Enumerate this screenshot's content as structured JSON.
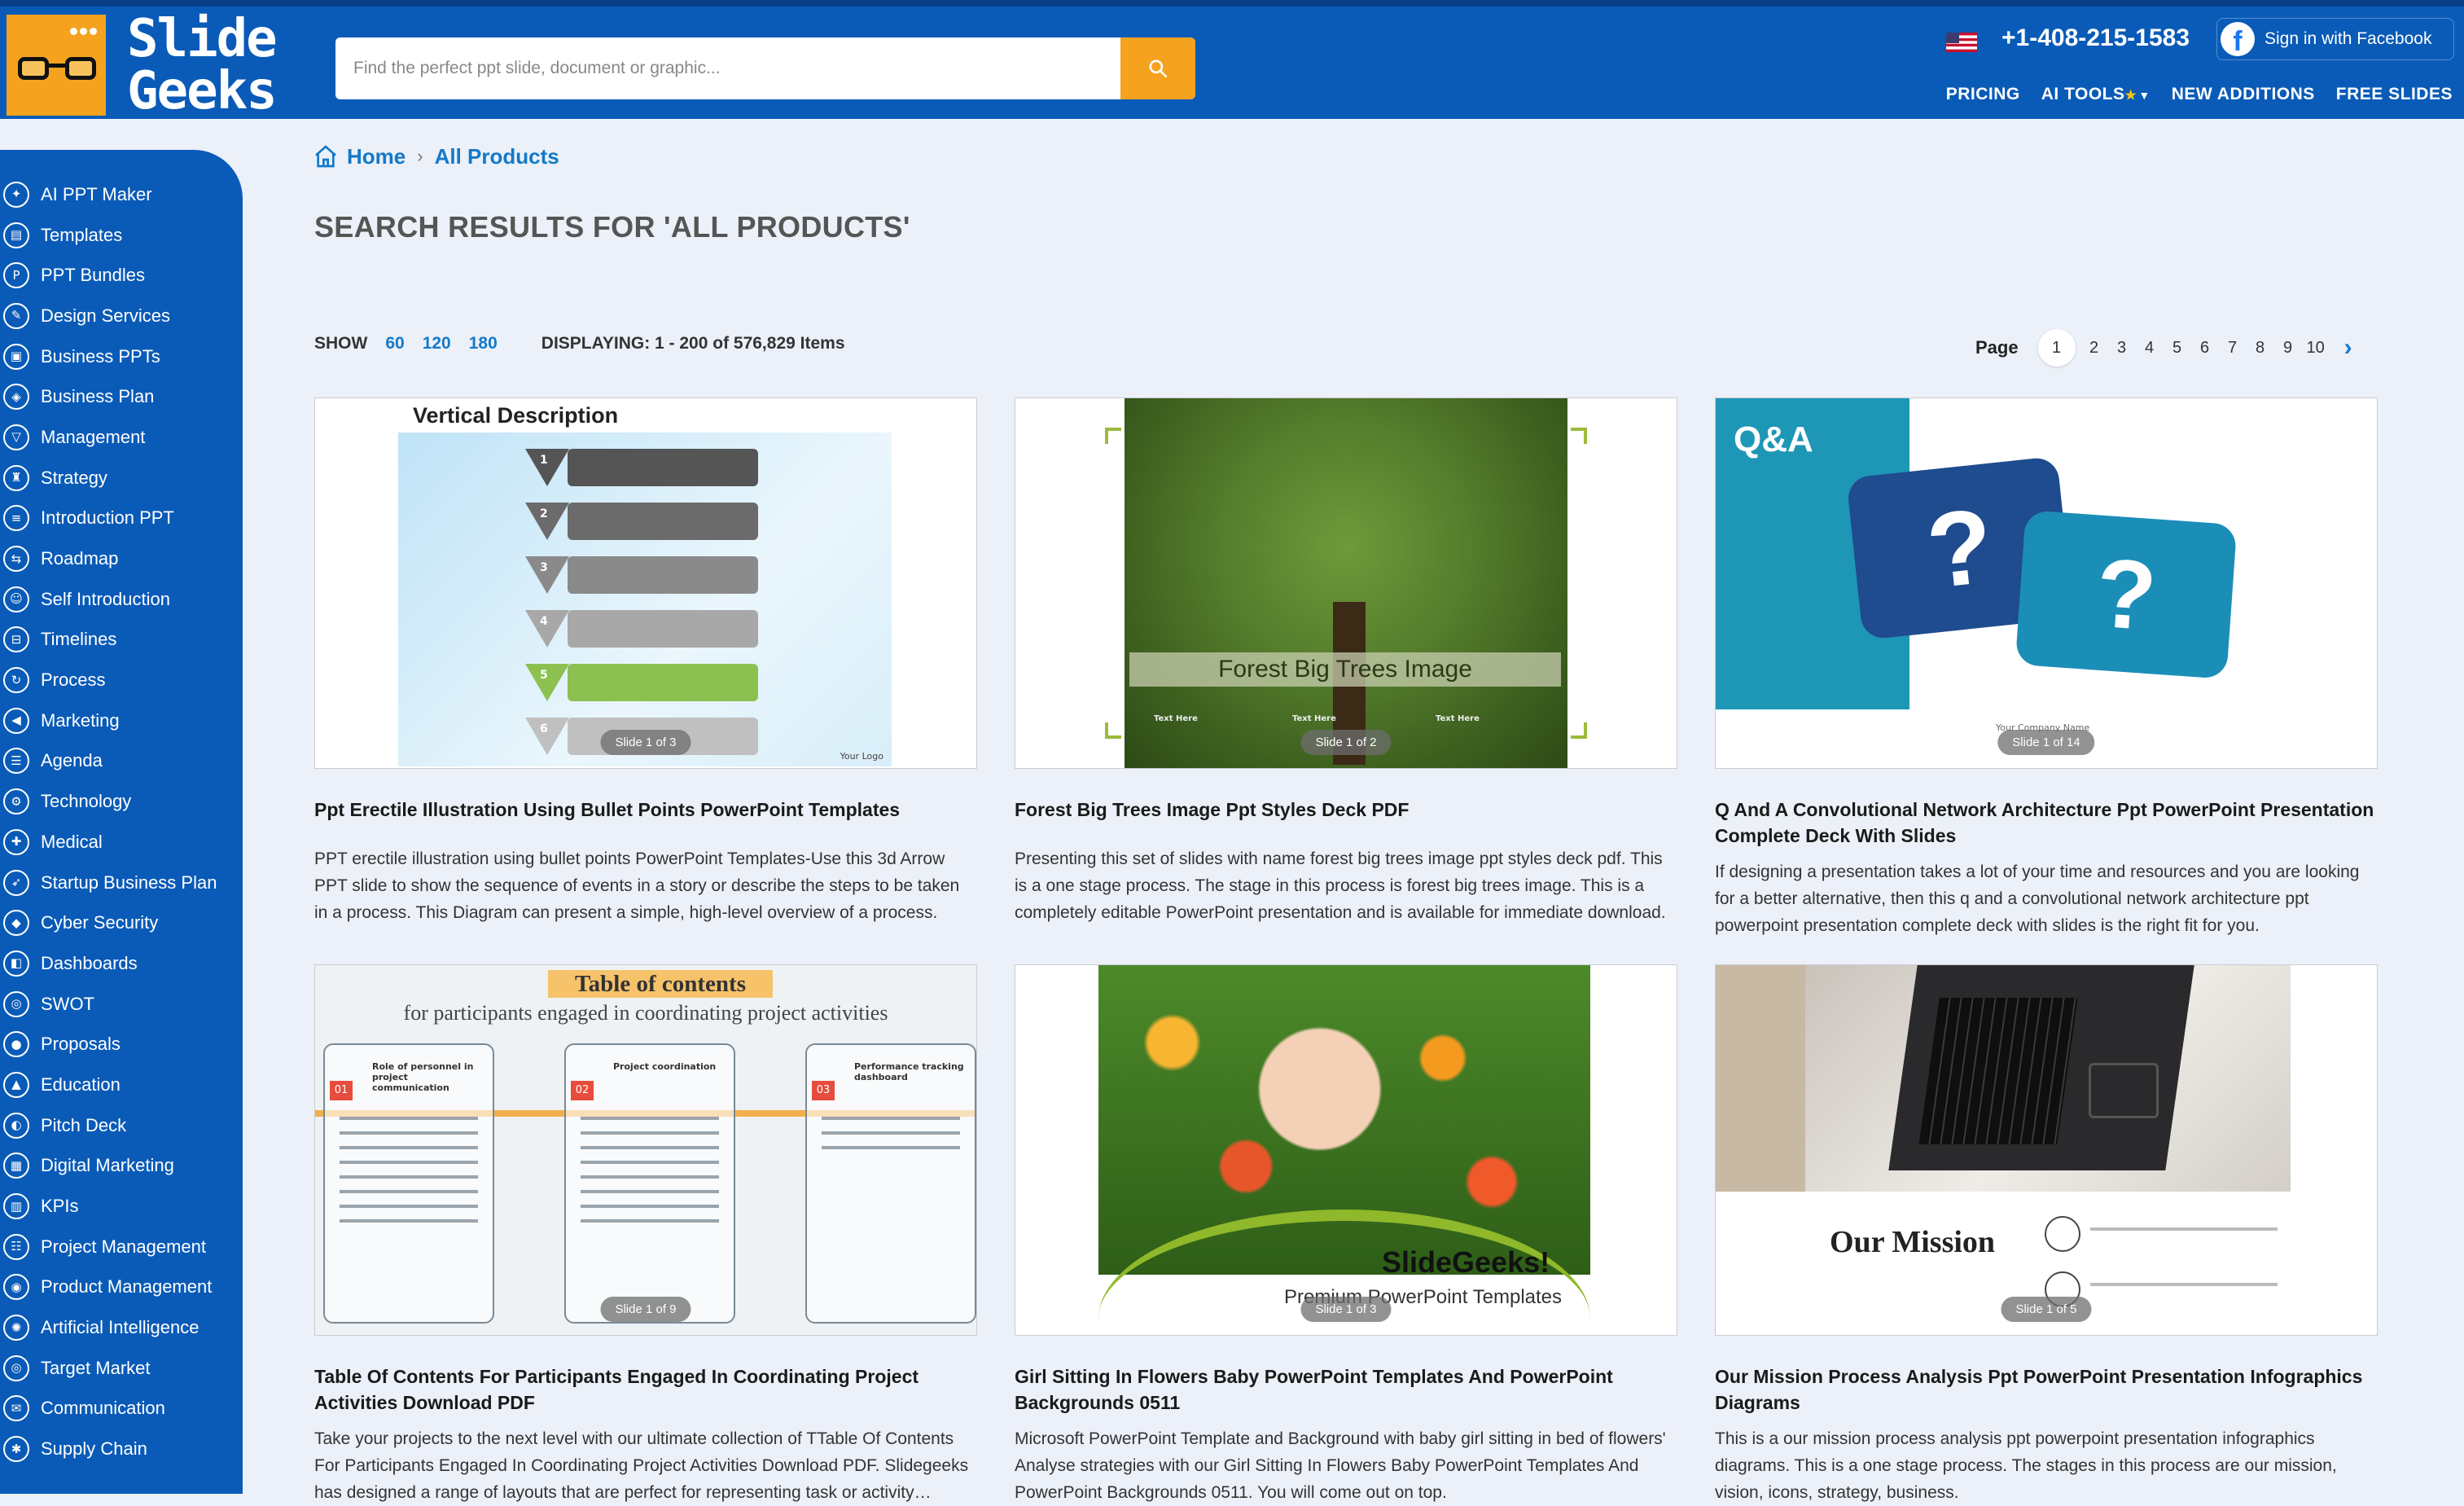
{
  "brand": {
    "logo_line1": "Slide",
    "logo_line2": "Geeks",
    "accent_color": "#f5a21e",
    "header_color": "#0a5bb8"
  },
  "search": {
    "placeholder": "Find the perfect ppt slide, document or graphic...",
    "value": "",
    "icon": "search-icon"
  },
  "header": {
    "flag_icon": "us-flag-icon",
    "phone": "+1-408-215-1583",
    "facebook_label": "Sign in with Facebook",
    "nav": {
      "pricing": "PRICING",
      "ai_tools": "AI TOOLS",
      "new_additions": "NEW ADDITIONS",
      "free_slides": "FREE SLIDES"
    }
  },
  "sidebar": {
    "items": [
      {
        "label": "AI PPT Maker",
        "icon": "ai-icon"
      },
      {
        "label": "Templates",
        "icon": "template-icon"
      },
      {
        "label": "PPT Bundles",
        "icon": "ppt-icon"
      },
      {
        "label": "Design Services",
        "icon": "design-icon"
      },
      {
        "label": "Business PPTs",
        "icon": "briefcase-icon"
      },
      {
        "label": "Business Plan",
        "icon": "plan-icon"
      },
      {
        "label": "Management",
        "icon": "funnel-icon"
      },
      {
        "label": "Strategy",
        "icon": "strategy-icon"
      },
      {
        "label": "Introduction PPT",
        "icon": "intro-icon"
      },
      {
        "label": "Roadmap",
        "icon": "roadmap-icon"
      },
      {
        "label": "Self Introduction",
        "icon": "person-icon"
      },
      {
        "label": "Timelines",
        "icon": "timeline-icon"
      },
      {
        "label": "Process",
        "icon": "process-icon"
      },
      {
        "label": "Marketing",
        "icon": "megaphone-icon"
      },
      {
        "label": "Agenda",
        "icon": "agenda-icon"
      },
      {
        "label": "Technology",
        "icon": "tech-icon"
      },
      {
        "label": "Medical",
        "icon": "medical-icon"
      },
      {
        "label": "Startup Business Plan",
        "icon": "rocket-icon"
      },
      {
        "label": "Cyber Security",
        "icon": "shield-icon"
      },
      {
        "label": "Dashboards",
        "icon": "dashboard-icon"
      },
      {
        "label": "SWOT",
        "icon": "swot-icon"
      },
      {
        "label": "Proposals",
        "icon": "bulb-icon"
      },
      {
        "label": "Education",
        "icon": "education-icon"
      },
      {
        "label": "Pitch Deck",
        "icon": "pitch-icon"
      },
      {
        "label": "Digital Marketing",
        "icon": "digital-icon"
      },
      {
        "label": "KPIs",
        "icon": "kpi-icon"
      },
      {
        "label": "Project Management",
        "icon": "project-icon"
      },
      {
        "label": "Product Management",
        "icon": "product-icon"
      },
      {
        "label": "Artificial Intelligence",
        "icon": "brain-icon"
      },
      {
        "label": "Target Market",
        "icon": "target-icon"
      },
      {
        "label": "Communication",
        "icon": "chat-icon"
      },
      {
        "label": "Supply Chain",
        "icon": "supply-icon"
      }
    ]
  },
  "breadcrumb": {
    "home": "Home",
    "current": "All Products"
  },
  "page_title": "SEARCH RESULTS FOR 'ALL PRODUCTS'",
  "show": {
    "label": "SHOW",
    "options": [
      "60",
      "120",
      "180"
    ],
    "displaying": "DISPLAYING: 1 - 200  of 576,829 Items"
  },
  "pagination": {
    "label": "Page",
    "current": "1",
    "pages": [
      "1",
      "2",
      "3",
      "4",
      "5",
      "6",
      "7",
      "8",
      "9",
      "10"
    ],
    "next_icon": "chevron-right-icon"
  },
  "products": [
    {
      "title": "Ppt Erectile Illustration Using Bullet Points PowerPoint Templates",
      "description": "PPT erectile illustration using bullet points PowerPoint Templates-Use this 3d Arrow PPT slide to show the sequence of events in a story or describe the steps to be taken in a process. This Diagram can present a simple, high-level overview of a process.",
      "slide_badge": "Slide 1 of 3",
      "thumb_title": "Vertical Description",
      "thumb_logo": "Your Logo",
      "thumb_numbers": [
        "1",
        "2",
        "3",
        "4",
        "5",
        "6"
      ]
    },
    {
      "title": "Forest Big Trees Image Ppt Styles Deck PDF",
      "description": "Presenting this set of slides with name forest big trees image ppt styles deck pdf. This is a one stage process. The stage in this process is forest big trees image. This is a completely editable PowerPoint presentation and is available for immediate download.",
      "slide_badge": "Slide 1 of 2",
      "thumb_banner": "Forest Big Trees Image",
      "thumb_text_labels": [
        "Text Here",
        "Text Here",
        "Text Here"
      ]
    },
    {
      "title": "Q And A Convolutional Network Architecture Ppt PowerPoint Presentation Complete Deck With Slides",
      "description": "If designing a presentation takes a lot of your time and resources and you are looking for a better alternative, then this q and a convolutional network architecture ppt powerpoint presentation complete deck with slides is the right fit for you.",
      "slide_badge": "Slide 1 of 14",
      "thumb_heading": "Q&A",
      "thumb_glyph": "?",
      "thumb_footer": "Your Company Name"
    },
    {
      "title": "Table Of Contents For Participants Engaged In Coordinating Project Activities Download PDF",
      "description": "Take your projects to the next level with our ultimate collection of TTable Of Contents For Participants Engaged In Coordinating Project Activities Download PDF. Slidegeeks has designed a range of layouts that are perfect for representing task or activity duration.",
      "slide_badge": "Slide 1 of 9",
      "thumb_band": "Table of contents",
      "thumb_sub": "for participants engaged in coordinating project activities",
      "thumb_cols": [
        {
          "num": "01",
          "head": "Role of personnel in project communication"
        },
        {
          "num": "02",
          "head": "Project coordination"
        },
        {
          "num": "03",
          "head": "Performance tracking dashboard"
        }
      ]
    },
    {
      "title": "Girl Sitting In Flowers Baby PowerPoint Templates And PowerPoint Backgrounds 0511",
      "description": "Microsoft PowerPoint Template and Background with baby girl sitting in bed of flowers' Analyse strategies with our Girl Sitting In Flowers Baby PowerPoint Templates And PowerPoint Backgrounds 0511. You will come out on top.",
      "slide_badge": "Slide 1 of 3",
      "thumb_brand": "SlideGeeks!",
      "thumb_sub": "Premium PowerPoint Templates"
    },
    {
      "title": "Our Mission Process Analysis Ppt PowerPoint Presentation Infographics Diagrams",
      "description": "This is a our mission process analysis ppt powerpoint presentation infographics diagrams. This is a one stage process. The stages in this process are our mission, vision, icons, strategy, business.",
      "slide_badge": "Slide 1 of 5",
      "thumb_title": "Our Mission"
    }
  ]
}
